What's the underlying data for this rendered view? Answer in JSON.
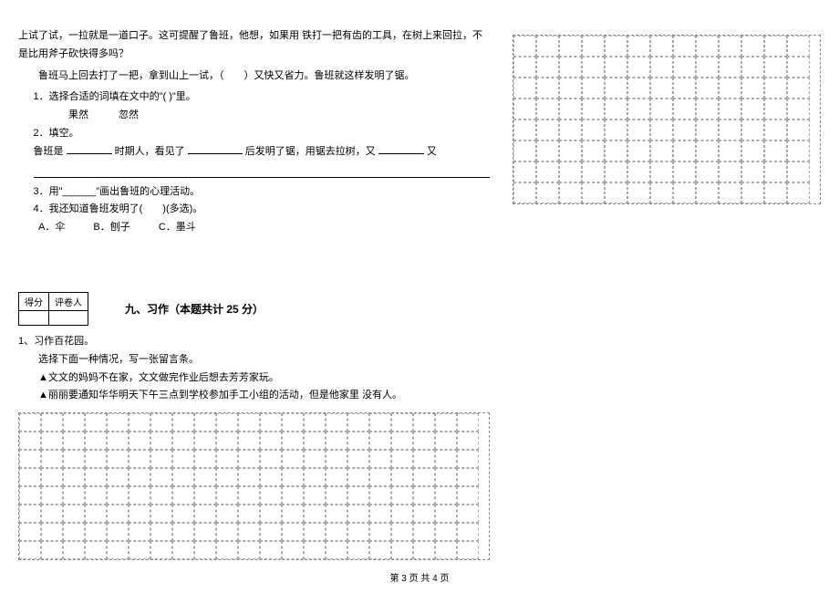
{
  "passage": {
    "p1": "上试了试，一拉就是一道口子。这可提醒了鲁班，他想，如果用 铁打一把有齿的工具，在树上来回拉，不是比用斧子砍快得多吗？",
    "p2": "鲁班马上回去打了一把，拿到山上一试，（　　）又快又省力。鲁班就这样发明了锯。"
  },
  "q1": {
    "label": "1．选择合适的词填在文中的\"( )\"里。",
    "opts": "果然　　　忽然"
  },
  "q2": {
    "label": "2．填空。",
    "text_a": "鲁班是",
    "text_b": "时期人，看见了",
    "text_c": "后发明了锯，用锯去拉树，又",
    "text_d": "又",
    "text_e": "。"
  },
  "q3": {
    "label": "3．用\"______\"画出鲁班的心理活动。"
  },
  "q4": {
    "label": "4．我还知道鲁班发明了(　　)(多选)。",
    "optA": "A．伞",
    "optB": "B．刨子",
    "optC": "C．墨斗"
  },
  "score": {
    "h1": "得分",
    "h2": "评卷人"
  },
  "section9": {
    "title": "九、习作（本题共计 25 分）"
  },
  "xizuo": {
    "l1": "1、习作百花园。",
    "l2": "选择下面一种情况，写一张留言条。",
    "l3": "▲文文的妈妈不在家，文文做完作业后想去芳芳家玩。",
    "l4": "▲丽丽要通知华华明天下午三点到学校参加手工小组的活动，但是他家里 没有人。"
  },
  "footer": "第 3 页 共 4 页"
}
